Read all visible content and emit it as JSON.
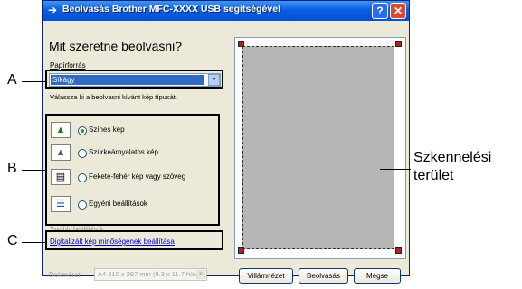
{
  "window": {
    "title": "Beolvasás Brother  MFC-XXXX  USB segítségével",
    "help_label": "?",
    "close_label": "✕"
  },
  "heading": "Mit szeretne beolvasni?",
  "paper": {
    "label": "Papírforrás",
    "value": "Síkágy",
    "arrow": "▼"
  },
  "instruction": "Válassza ki a beolvasni kívánt kép típusát.",
  "image_types": [
    {
      "label": "Színes kép",
      "icon": "color-photo-icon",
      "checked": true
    },
    {
      "label": "Szürkeárnyalatos kép",
      "icon": "grayscale-photo-icon",
      "checked": false
    },
    {
      "label": "Fekete-fehér kép vagy szöveg",
      "icon": "black-white-document-icon",
      "checked": false
    },
    {
      "label": "Egyéni beállítások",
      "icon": "custom-settings-icon",
      "checked": false
    }
  ],
  "settings": {
    "heading": "További beállítások",
    "link": "Digitalizált kép minőségének beállítása"
  },
  "document_size": {
    "label": "Dokméret:",
    "value": "A4 210 x 297 mm (8.3 x 11.7 hüv",
    "arrow": "▼"
  },
  "buttons": {
    "preview": "Villámnézet",
    "scan": "Beolvasás",
    "cancel": "Mégse"
  },
  "callouts": {
    "a": "A",
    "b": "B",
    "c": "C",
    "scan_area_line1": "Szkennelési",
    "scan_area_line2": "terület"
  },
  "colors": {
    "titlebar": "#0a5fe0",
    "dialog_bg": "#ece9d8",
    "selection": "#316ac5",
    "link": "#0000cc",
    "corner_handles": "#b31f1f"
  }
}
